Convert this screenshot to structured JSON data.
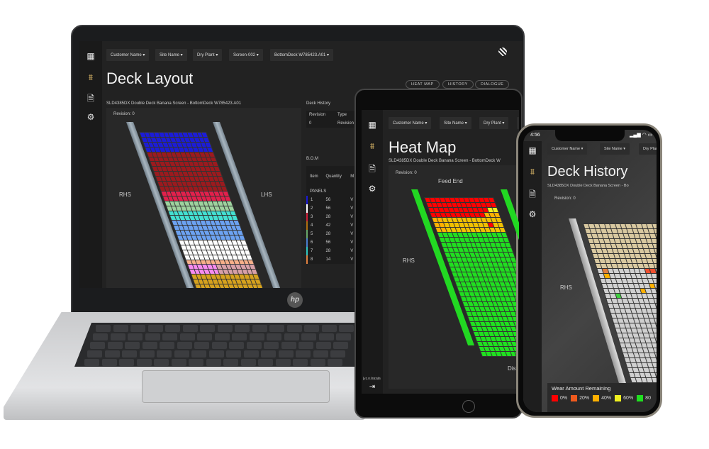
{
  "nav": {
    "customer": "Customer Name",
    "site": "Site Name",
    "plant": "Dry Plant",
    "screen": "Screen-002",
    "deck": "BottomDeck W785423.A01"
  },
  "laptop": {
    "title": "Deck Layout",
    "tabs": [
      "HEAT MAP",
      "HISTORY",
      "DIALOGUE"
    ],
    "subtitle": "SLD4385DX Double Deck Banana Screen - BottomDeck W785423.A01",
    "revision": "Revision: 0",
    "rhs": "RHS",
    "lhs": "LHS",
    "deck_history": {
      "title": "Deck History",
      "headers": [
        "Revision",
        "Type"
      ],
      "rows": [
        [
          "0",
          "Revision"
        ]
      ]
    },
    "bom": {
      "title": "B.O.M",
      "headers": [
        "Item",
        "Quantity",
        "M N"
      ],
      "section": "PANELS",
      "rows": [
        {
          "item": "1",
          "qty": "56",
          "code": "V",
          "color": "#1a1ad6"
        },
        {
          "item": "2",
          "qty": "56",
          "code": "V",
          "color": "#ffffff"
        },
        {
          "item": "3",
          "qty": "28",
          "code": "V",
          "color": "#d0203a"
        },
        {
          "item": "4",
          "qty": "42",
          "code": "V",
          "color": "#b07010"
        },
        {
          "item": "5",
          "qty": "28",
          "code": "V",
          "color": "#6aa86a"
        },
        {
          "item": "6",
          "qty": "56",
          "code": "V",
          "color": "#4a7fd0"
        },
        {
          "item": "7",
          "qty": "28",
          "code": "V",
          "color": "#30c8c0"
        },
        {
          "item": "8",
          "qty": "14",
          "code": "V",
          "color": "#e08040"
        }
      ]
    },
    "deck_bands": [
      {
        "rows": 4,
        "color": "#1c1cd8"
      },
      {
        "rows": 8,
        "color": "#9c1a1e"
      },
      {
        "rows": 2,
        "color": "#e3204c"
      },
      {
        "rows": 2,
        "color": "#9fd39f"
      },
      {
        "rows": 2,
        "color": "#43e0d2"
      },
      {
        "rows": 4,
        "color": "#6ca2f2"
      },
      {
        "rows": 4,
        "color": "#ffffff"
      },
      {
        "rows": 1,
        "color": "#f7b08a"
      },
      {
        "rows": 2,
        "color": "#d8a0a8"
      },
      {
        "rows": 3,
        "color": "#d6a21e"
      }
    ]
  },
  "tablet": {
    "title": "Heat Map",
    "subtitle": "SLD4385DX Double Deck Banana Screen - BottomDeck W",
    "revision": "Revision: 0",
    "feed": "Feed End",
    "rhs": "RHS",
    "discharge": "Dis",
    "version": "[v1.0.f453d6"
  },
  "phone": {
    "time": "4:56",
    "title": "Deck History",
    "subtitle": "SLD4385DX Double Deck Banana Screen - Bo",
    "revision": "Revision: 0",
    "rhs": "RHS",
    "legend_title": "Wear Amount Remaining",
    "legend": [
      {
        "label": "0%",
        "color": "#ff0000"
      },
      {
        "label": "20%",
        "color": "#f05a1e"
      },
      {
        "label": "40%",
        "color": "#ffb000"
      },
      {
        "label": "60%",
        "color": "#f0f020"
      },
      {
        "label": "80",
        "color": "#20e020"
      }
    ]
  }
}
